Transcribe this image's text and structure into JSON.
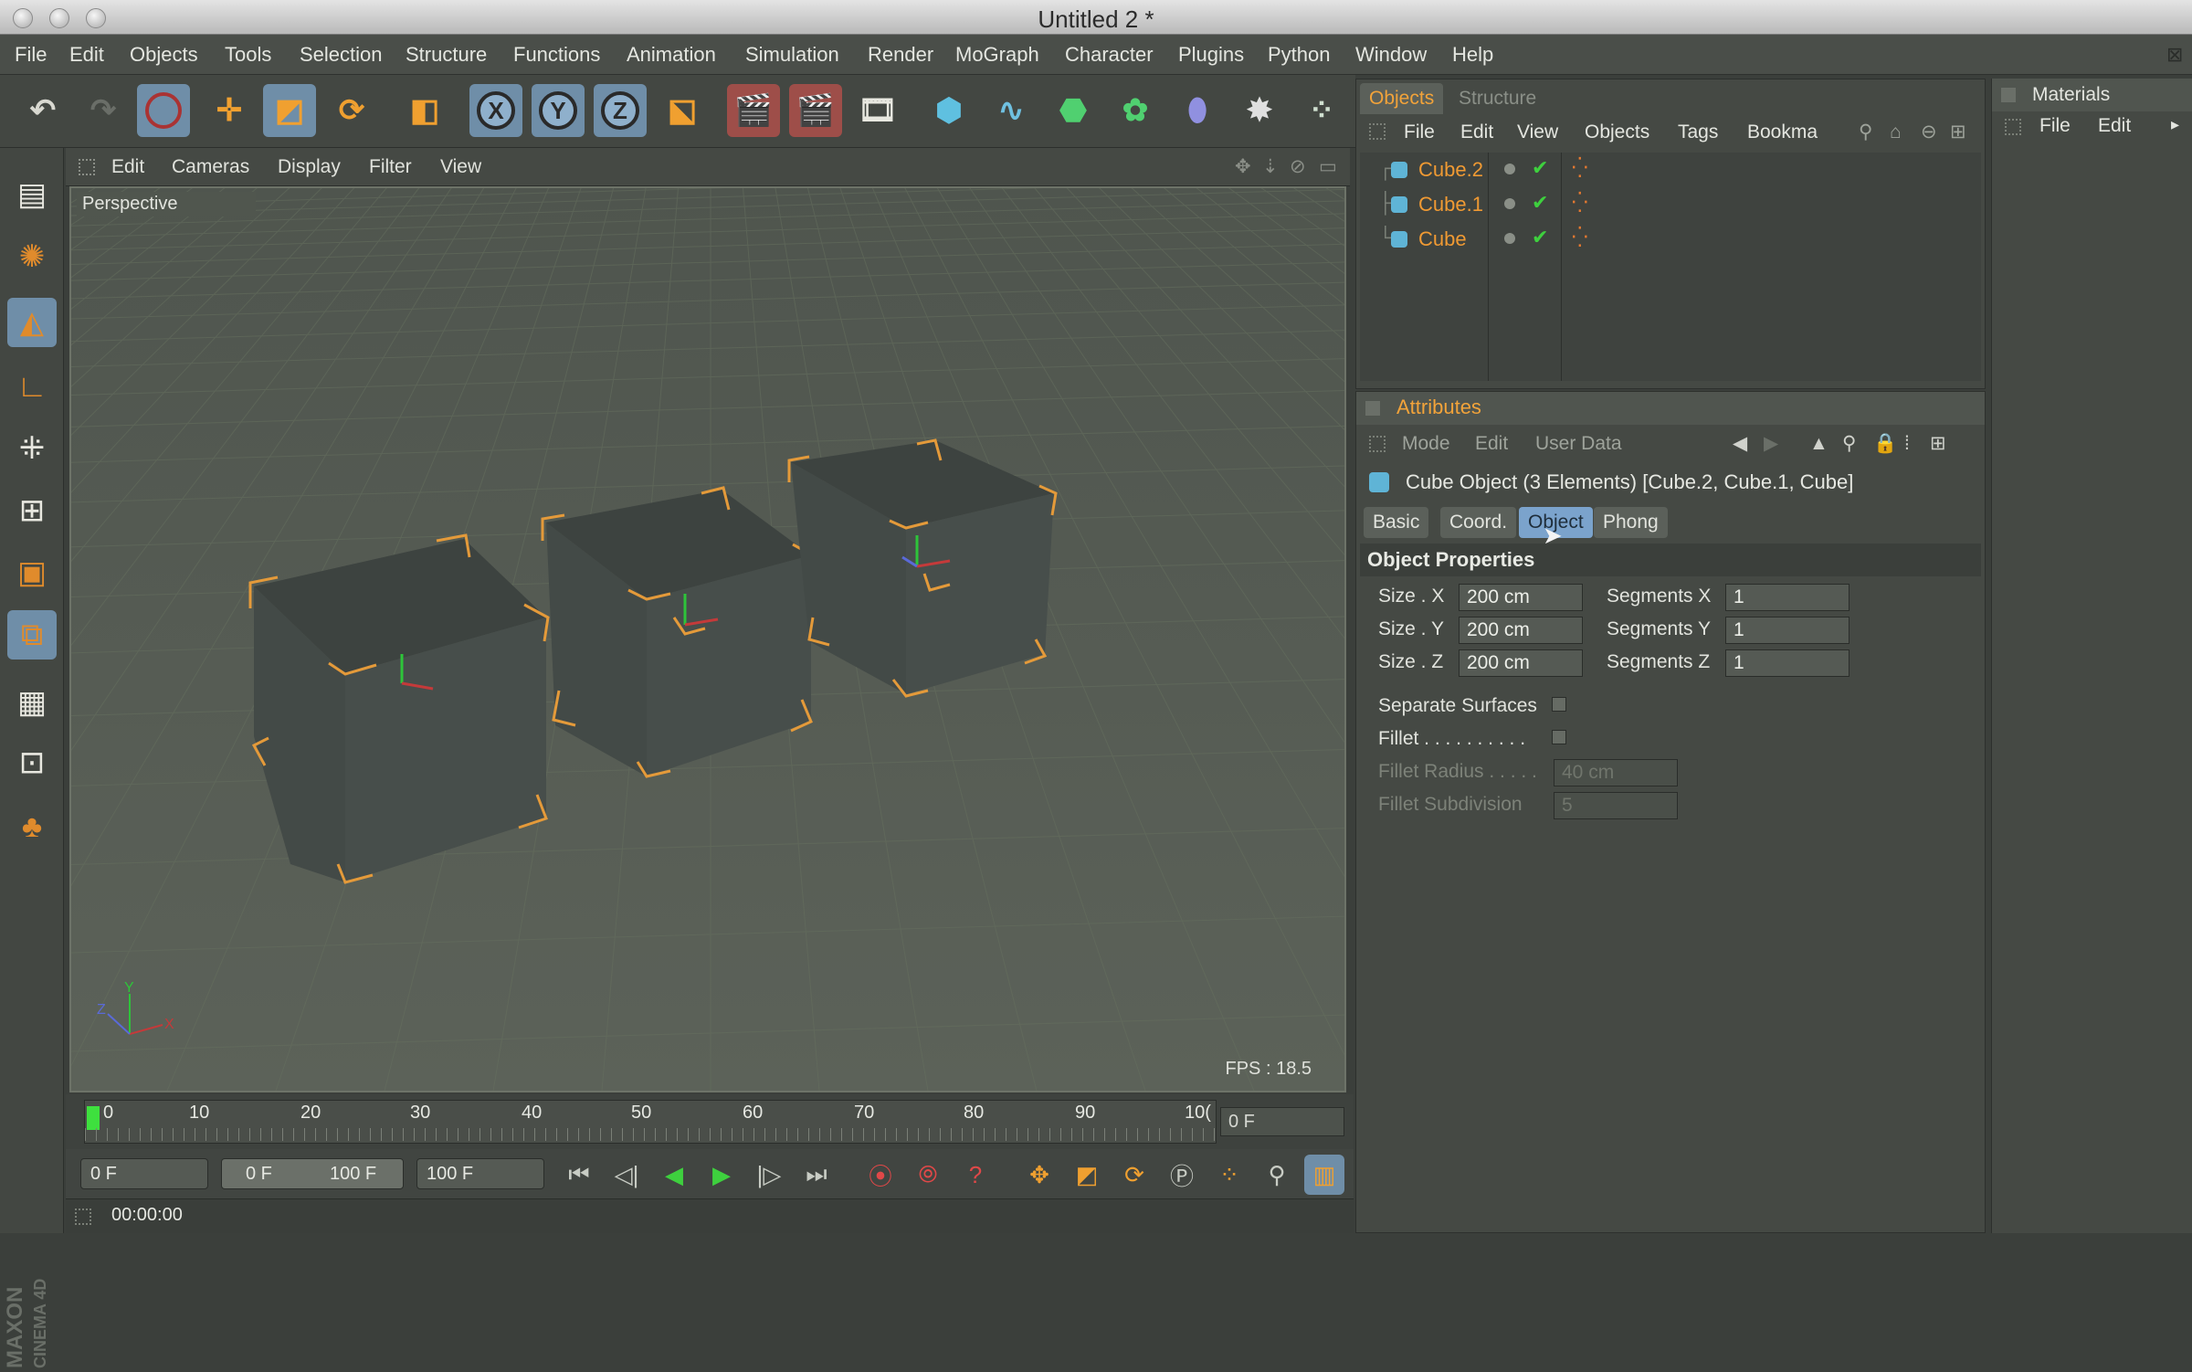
{
  "window": {
    "title": "Untitled 2 *"
  },
  "menubar": [
    "File",
    "Edit",
    "Objects",
    "Tools",
    "Selection",
    "Structure",
    "Functions",
    "Animation",
    "Simulation",
    "Render",
    "MoGraph",
    "Character",
    "Plugins",
    "Python",
    "Window",
    "Help"
  ],
  "toolbar": {
    "axis_x": "X",
    "axis_y": "Y",
    "axis_z": "Z"
  },
  "viewport": {
    "menu": [
      "Edit",
      "Cameras",
      "Display",
      "Filter",
      "View"
    ],
    "label": "Perspective",
    "fps": "FPS : 18.5",
    "gizmo": {
      "x": "X",
      "y": "Y",
      "z": "Z"
    }
  },
  "timeline": {
    "ticks": [
      "0",
      "10",
      "20",
      "30",
      "40",
      "50",
      "60",
      "70",
      "80",
      "90",
      "10("
    ],
    "current_frame": "0 F",
    "start": "0 F",
    "range_start": "0 F",
    "range_end": "100 F",
    "end": "100 F",
    "time": "00:00:00"
  },
  "objects_panel": {
    "tabs": [
      "Objects",
      "Structure"
    ],
    "menu": [
      "File",
      "Edit",
      "View",
      "Objects",
      "Tags",
      "Bookma"
    ],
    "items": [
      "Cube.2",
      "Cube.1",
      "Cube"
    ]
  },
  "attributes": {
    "title": "Attributes",
    "menu": [
      "Mode",
      "Edit",
      "User Data"
    ],
    "description": "Cube Object (3 Elements) [Cube.2, Cube.1, Cube]",
    "tabs": [
      "Basic",
      "Coord.",
      "Object",
      "Phong"
    ],
    "active_tab": "Object",
    "section": "Object Properties",
    "size_x_label": "Size . X",
    "size_x": "200 cm",
    "size_y_label": "Size . Y",
    "size_y": "200 cm",
    "size_z_label": "Size . Z",
    "size_z": "200 cm",
    "seg_x_label": "Segments X",
    "seg_x": "1",
    "seg_y_label": "Segments Y",
    "seg_y": "1",
    "seg_z_label": "Segments Z",
    "seg_z": "1",
    "separate_surfaces": "Separate Surfaces",
    "fillet": "Fillet . . . . . . . . . .",
    "fillet_radius_label": "Fillet Radius . . . . .",
    "fillet_radius": "40 cm",
    "fillet_subdivision_label": "Fillet Subdivision",
    "fillet_subdivision": "5"
  },
  "materials": {
    "title": "Materials",
    "menu": [
      "File",
      "Edit"
    ]
  },
  "brand": {
    "line1": "MAXON",
    "line2": "CINEMA 4D"
  },
  "colors": {
    "accent": "#f2a33a",
    "selection_blue": "#6f8ea8",
    "background": "#3b3f3b"
  }
}
